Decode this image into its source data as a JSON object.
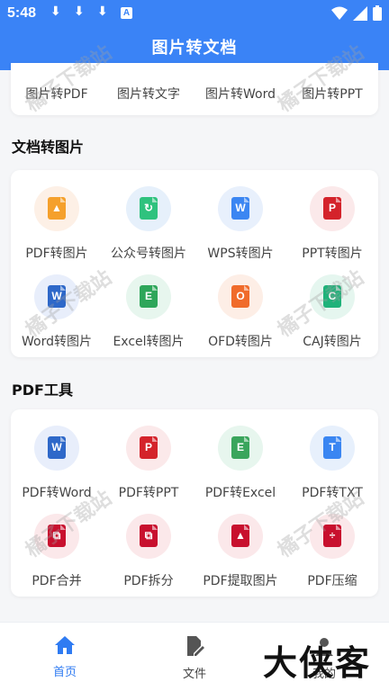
{
  "status_bar": {
    "time": "5:48",
    "download_glyph": "⬇",
    "accessibility_glyph": "A",
    "icons": [
      "download-icon",
      "download-icon",
      "download-icon",
      "accessibility-icon",
      "wifi-icon",
      "cellular-icon",
      "battery-icon"
    ]
  },
  "app_bar": {
    "title": "图片转文档"
  },
  "top_card": {
    "items": [
      "图片转PDF",
      "图片转文字",
      "图片转Word",
      "图片转PPT"
    ]
  },
  "section_doc_to_image": {
    "title": "文档转图片",
    "items": [
      {
        "label": "PDF转图片",
        "icon": "image-file-icon",
        "glyph": "▲",
        "color": "#f5a02c",
        "bg": "#fdf0e6"
      },
      {
        "label": "公众号转图片",
        "icon": "wechat-article-icon",
        "glyph": "↻",
        "color": "#2ec27e",
        "bg": "#e6f0fb"
      },
      {
        "label": "WPS转图片",
        "icon": "wps-file-icon",
        "glyph": "W",
        "color": "#3b86f2",
        "bg": "#e8f0fc"
      },
      {
        "label": "PPT转图片",
        "icon": "ppt-file-icon",
        "glyph": "P",
        "color": "#d4232b",
        "bg": "#fbe9ea"
      },
      {
        "label": "Word转图片",
        "icon": "word-file-icon",
        "glyph": "W",
        "color": "#2e68c9",
        "bg": "#e8eefb"
      },
      {
        "label": "Excel转图片",
        "icon": "excel-file-icon",
        "glyph": "E",
        "color": "#2ea65a",
        "bg": "#e7f6ee"
      },
      {
        "label": "OFD转图片",
        "icon": "ofd-file-icon",
        "glyph": "O",
        "color": "#f06b2b",
        "bg": "#fdeee6"
      },
      {
        "label": "CAJ转图片",
        "icon": "caj-file-icon",
        "glyph": "C",
        "color": "#1fb27a",
        "bg": "#e5f6ef"
      }
    ]
  },
  "section_pdf_tools": {
    "title": "PDF工具",
    "items": [
      {
        "label": "PDF转Word",
        "icon": "word-file-icon",
        "glyph": "W",
        "color": "#2e68c9",
        "bg": "#e8eefb"
      },
      {
        "label": "PDF转PPT",
        "icon": "ppt-file-icon",
        "glyph": "P",
        "color": "#d4232b",
        "bg": "#fbe9ea"
      },
      {
        "label": "PDF转Excel",
        "icon": "excel-file-icon",
        "glyph": "E",
        "color": "#3aa55c",
        "bg": "#e7f6ee"
      },
      {
        "label": "PDF转TXT",
        "icon": "txt-file-icon",
        "glyph": "T",
        "color": "#3a86f2",
        "bg": "#e7f0fc"
      },
      {
        "label": "PDF合并",
        "icon": "pdf-merge-icon",
        "glyph": "⧉",
        "color": "#c8102e",
        "bg": "#fbe8ea"
      },
      {
        "label": "PDF拆分",
        "icon": "pdf-split-icon",
        "glyph": "⧉",
        "color": "#c8102e",
        "bg": "#fbe8ea"
      },
      {
        "label": "PDF提取图片",
        "icon": "pdf-extract-image-icon",
        "glyph": "▲",
        "color": "#c8102e",
        "bg": "#fbe8ea"
      },
      {
        "label": "PDF压缩",
        "icon": "pdf-compress-icon",
        "glyph": "÷",
        "color": "#c8102e",
        "bg": "#fbe8ea"
      }
    ]
  },
  "watermark": "橘子下载站",
  "bottom_nav": {
    "items": [
      {
        "label": "首页",
        "icon": "home-icon",
        "active": true
      },
      {
        "label": "文件",
        "icon": "document-edit-icon",
        "active": false
      },
      {
        "label": "我的",
        "icon": "profile-icon",
        "active": false
      }
    ]
  },
  "brand_logo_text": "大侠客",
  "colors": {
    "primary": "#3a83f6",
    "active_nav": "#2f7bf2",
    "background": "#f5f6f8"
  }
}
